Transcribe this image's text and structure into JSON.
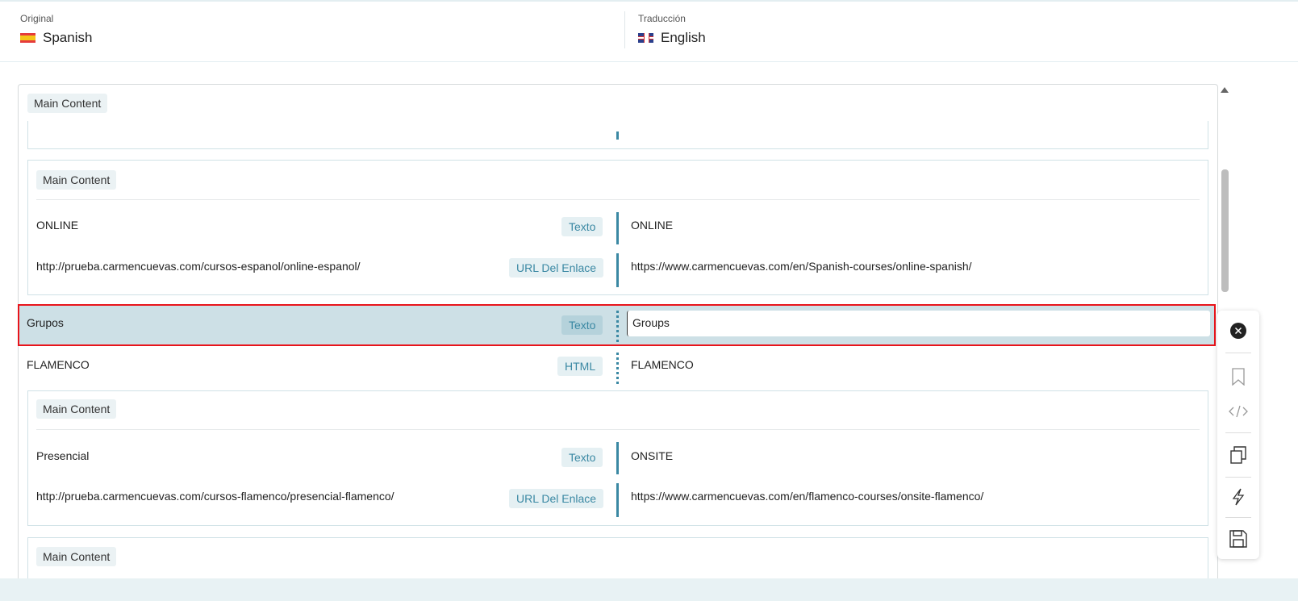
{
  "header": {
    "original_label": "Original",
    "original_lang": "Spanish",
    "translation_label": "Traducción",
    "translation_lang": "English"
  },
  "tag": "Main Content",
  "groups": [
    {
      "rows": [
        {
          "source": "ONLINE",
          "type": "Texto",
          "target": "ONLINE"
        },
        {
          "source": "http://prueba.carmencuevas.com/cursos-espanol/online-espanol/",
          "type": "URL Del Enlace",
          "target": "https://www.carmencuevas.com/en/Spanish-courses/online-spanish/"
        }
      ]
    },
    {
      "rows": [
        {
          "source": "Presencial",
          "type": "Texto",
          "target": "ONSITE"
        },
        {
          "source": "http://prueba.carmencuevas.com/cursos-flamenco/presencial-flamenco/",
          "type": "URL Del Enlace",
          "target": "https://www.carmencuevas.com/en/flamenco-courses/onsite-flamenco/"
        }
      ]
    }
  ],
  "active_row": {
    "source": "Grupos",
    "type": "Texto",
    "target": "Groups"
  },
  "flamenco_row": {
    "source": "FLAMENCO",
    "type": "HTML",
    "target": "FLAMENCO"
  },
  "toolbar": [
    "close-icon",
    "bookmark-icon",
    "code-icon",
    "copy-icon",
    "lightning-icon",
    "save-icon"
  ]
}
